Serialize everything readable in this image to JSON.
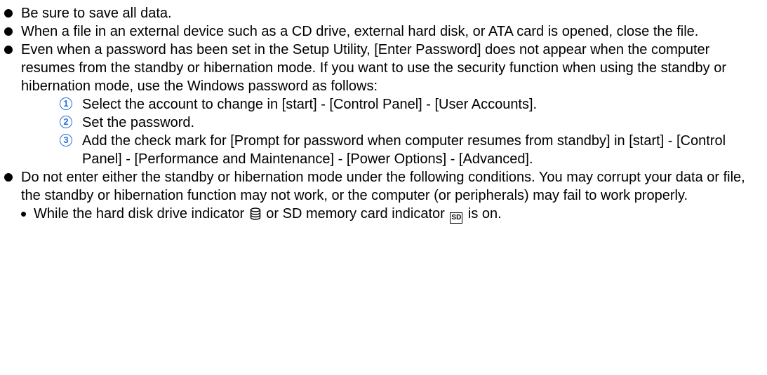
{
  "bullets": [
    {
      "text": "Be sure to save all data."
    },
    {
      "text": "When a file in an external device such as a CD drive, external hard disk, or ATA card is opened, close the file."
    },
    {
      "text": "Even when a password has been set in the Setup Utility, [Enter Password] does not appear when the computer resumes from the standby or hibernation mode. If you want to use the security function when using the standby or hibernation mode, use the Windows password as follows:"
    },
    {
      "text": "Do not enter either the standby or hibernation mode under the following conditions. You may corrupt your data or file, the standby or hibernation function may not work, or the computer (or peripherals) may fail to work properly."
    }
  ],
  "steps": [
    {
      "num": "1",
      "text": "Select the account to change in [start] - [Control Panel] - [User Accounts]."
    },
    {
      "num": "2",
      "text": "Set the password."
    },
    {
      "num": "3",
      "text": "Add the check mark for [Prompt for password when computer resumes from standby] in [start] - [Control Panel] - [Performance and Maintenance] - [Power Options] - [Advanced]."
    }
  ],
  "sub_item": {
    "text_before": "While the hard disk drive indicator",
    "text_middle": "or SD memory card indicator",
    "text_after": "is on.",
    "hdd_icon": "hard-disk-indicator-icon",
    "sd_icon": "sd-card-indicator-icon",
    "sd_icon_label": "SD"
  },
  "colors": {
    "step_number": "#2a6fd6",
    "text": "#000000"
  }
}
